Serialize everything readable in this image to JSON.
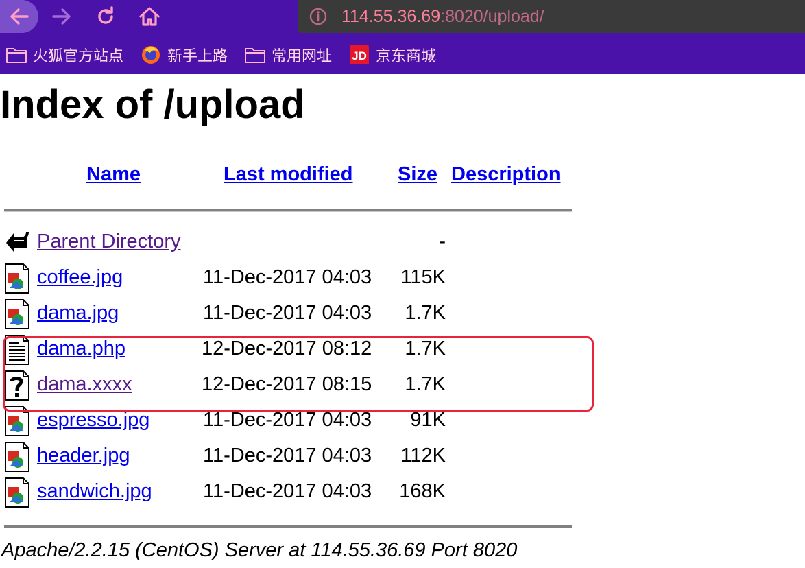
{
  "browser": {
    "url_host": "114.55.36.69",
    "url_rest": ":8020/upload/",
    "bookmarks": [
      {
        "label": "火狐官方站点",
        "icon": "folder-icon"
      },
      {
        "label": "新手上路",
        "icon": "firefox-icon"
      },
      {
        "label": "常用网址",
        "icon": "folder-icon"
      },
      {
        "label": "京东商城",
        "icon": "jd-icon"
      }
    ],
    "colors": {
      "toolbar": "#4a12a8",
      "url_text": "#ff7f9b",
      "highlight": "#e8243c"
    }
  },
  "listing": {
    "title": "Index of /upload",
    "columns": {
      "name": "Name",
      "last_modified": "Last modified",
      "size": "Size",
      "description": "Description"
    },
    "parent": {
      "name": "Parent Directory",
      "size": "-"
    },
    "rows": [
      {
        "name": "coffee.jpg",
        "date": "11-Dec-2017 04:03",
        "size": "115K",
        "icon": "image-icon"
      },
      {
        "name": "dama.jpg",
        "date": "11-Dec-2017 04:03",
        "size": "1.7K",
        "icon": "image-icon"
      },
      {
        "name": "dama.php",
        "date": "12-Dec-2017 08:12",
        "size": "1.7K",
        "icon": "text-file-icon"
      },
      {
        "name": "dama.xxxx",
        "date": "12-Dec-2017 08:15",
        "size": "1.7K",
        "icon": "unknown-file-icon"
      },
      {
        "name": "espresso.jpg",
        "date": "11-Dec-2017 04:03",
        "size": "91K",
        "icon": "image-icon"
      },
      {
        "name": "header.jpg",
        "date": "11-Dec-2017 04:03",
        "size": "112K",
        "icon": "image-icon"
      },
      {
        "name": "sandwich.jpg",
        "date": "11-Dec-2017 04:03",
        "size": "168K",
        "icon": "image-icon"
      }
    ],
    "footer": "Apache/2.2.15 (CentOS) Server at 114.55.36.69 Port 8020"
  }
}
